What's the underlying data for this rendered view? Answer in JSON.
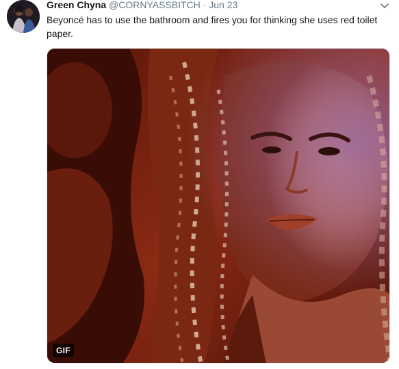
{
  "tweet": {
    "author_name": "Green Chyna",
    "handle": "@CORNYASSBITCH",
    "separator": "·",
    "date": "Jun 23",
    "text": "Beyoncé has to use the bathroom and fires you for thinking she uses red toilet paper.",
    "menu_icon": "chevron-down-icon",
    "avatar_icon": "avatar-photo"
  },
  "media": {
    "type": "gif",
    "badge_label": "GIF"
  },
  "colors": {
    "name": "#14171a",
    "meta": "#657786",
    "media_border": "#e1e8ed",
    "badge_bg": "#000000"
  }
}
